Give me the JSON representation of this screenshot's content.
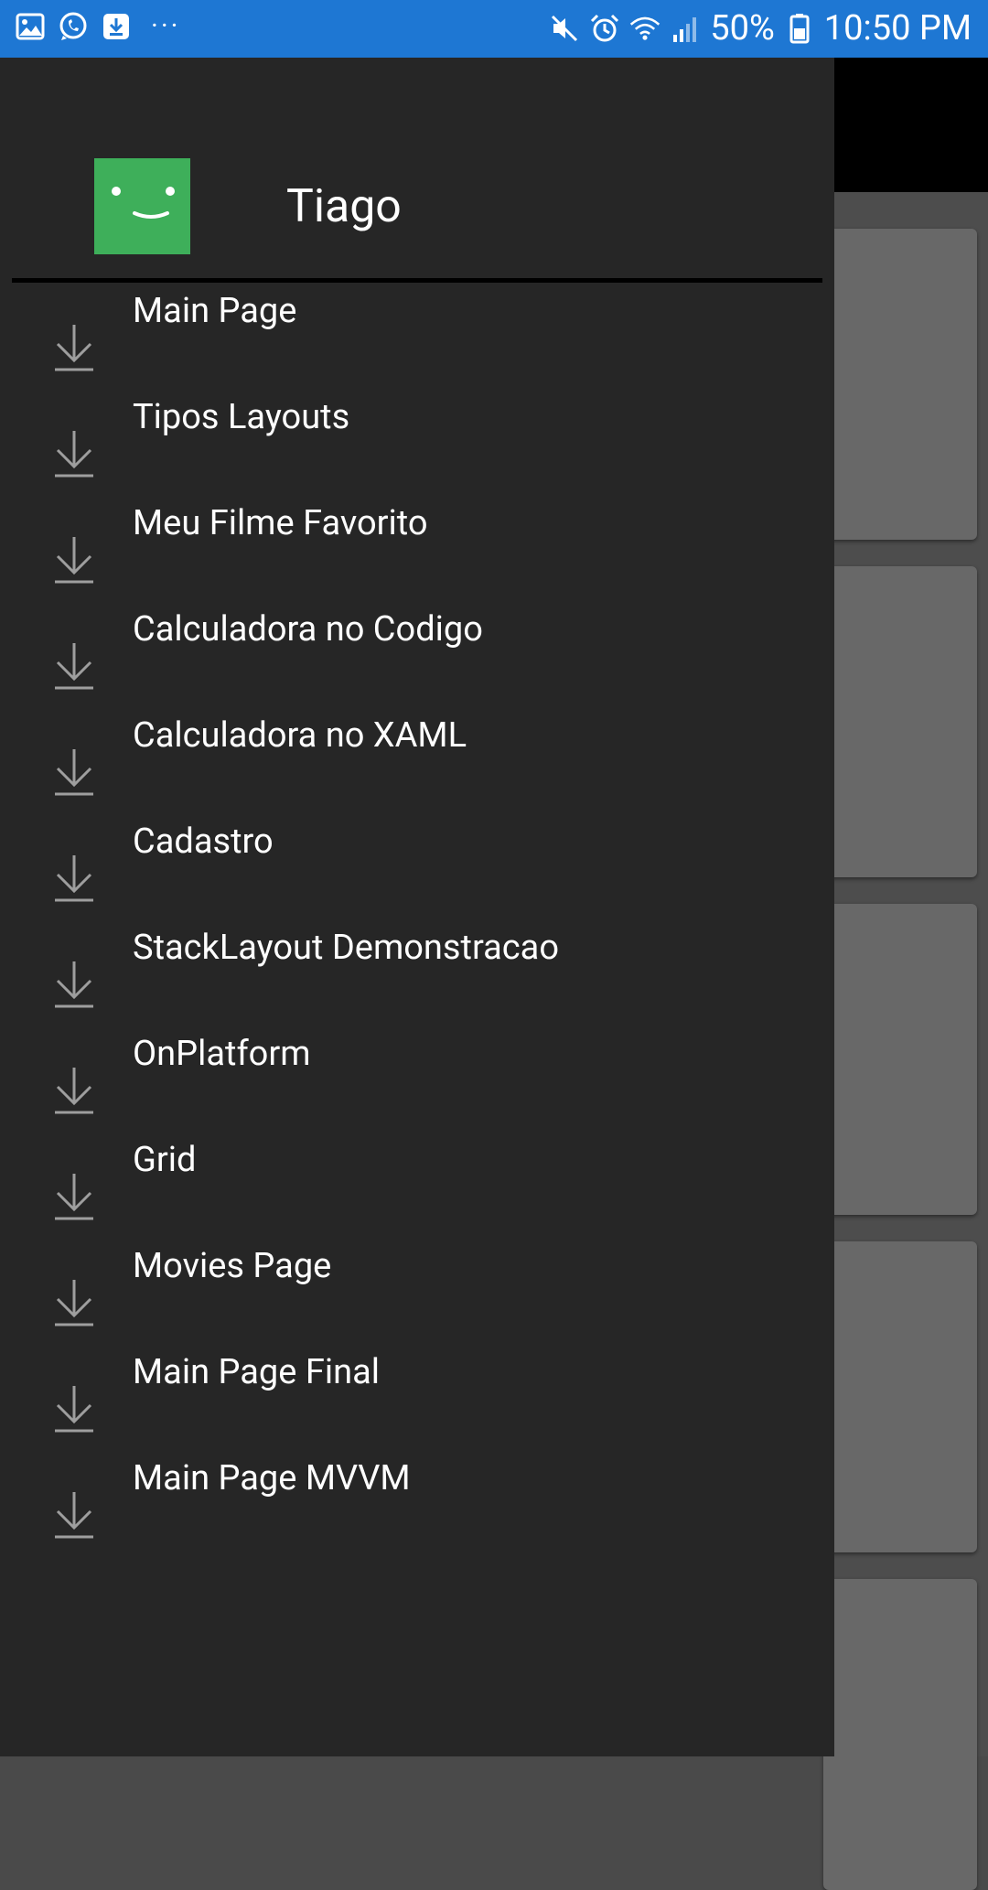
{
  "status_bar": {
    "left_icons": [
      "gallery-icon",
      "whatsapp-icon",
      "download-notification-icon"
    ],
    "more_label": "···",
    "right_icons": [
      "mute-icon",
      "alarm-icon",
      "wifi-icon",
      "signal-icon",
      "battery-icon"
    ],
    "battery_percent": "50%",
    "time": "10:50 PM",
    "background_color": "#1e77d3"
  },
  "drawer": {
    "header": {
      "avatar_icon": "smiley-avatar-icon",
      "avatar_color": "#3eaf5a",
      "username": "Tiago"
    },
    "item_icon": "download-arrow-icon",
    "items": [
      {
        "label": "Main Page"
      },
      {
        "label": "Tipos Layouts"
      },
      {
        "label": "Meu Filme Favorito"
      },
      {
        "label": "Calculadora no Codigo"
      },
      {
        "label": "Calculadora no XAML"
      },
      {
        "label": "Cadastro"
      },
      {
        "label": "StackLayout Demonstracao"
      },
      {
        "label": "OnPlatform"
      },
      {
        "label": "Grid"
      },
      {
        "label": "Movies Page"
      },
      {
        "label": "Main Page Final"
      },
      {
        "label": "Main Page MVVM"
      }
    ],
    "background_color": "#262626"
  }
}
